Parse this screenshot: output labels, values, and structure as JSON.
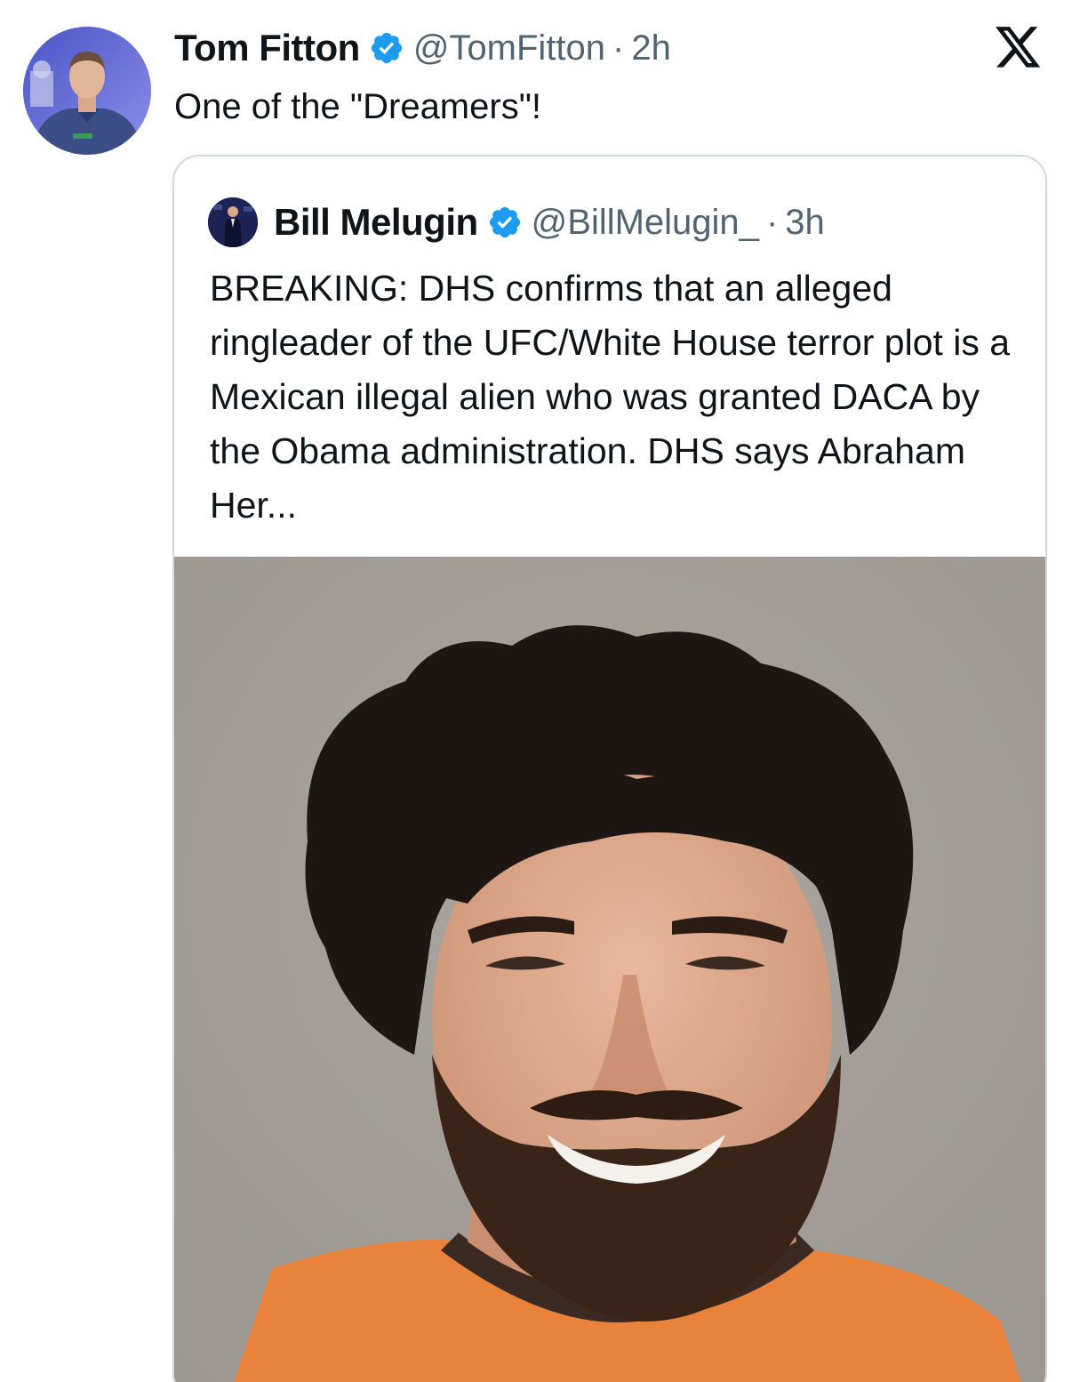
{
  "tweet": {
    "author_name": "Tom Fitton",
    "handle": "@TomFitton",
    "separator": "·",
    "time": "2h",
    "text": "One of the \"Dreamers\"!",
    "avatar_icon": "profile-photo",
    "verified_icon": "verified-badge-icon",
    "logo_icon": "x-logo-icon"
  },
  "quote": {
    "author_name": "Bill Melugin",
    "handle": "@BillMelugin_",
    "separator": "·",
    "time": "3h",
    "text": "BREAKING: DHS confirms that an alleged ringleader of the UFC/White House terror plot is a Mexican illegal alien who was granted DACA by the Obama administration. DHS says Abraham Her...",
    "media": "mugshot-photo"
  },
  "colors": {
    "verified_blue": "#1d9bf0",
    "text_primary": "#0f1419",
    "text_secondary": "#536471",
    "border": "#cfd9de"
  }
}
